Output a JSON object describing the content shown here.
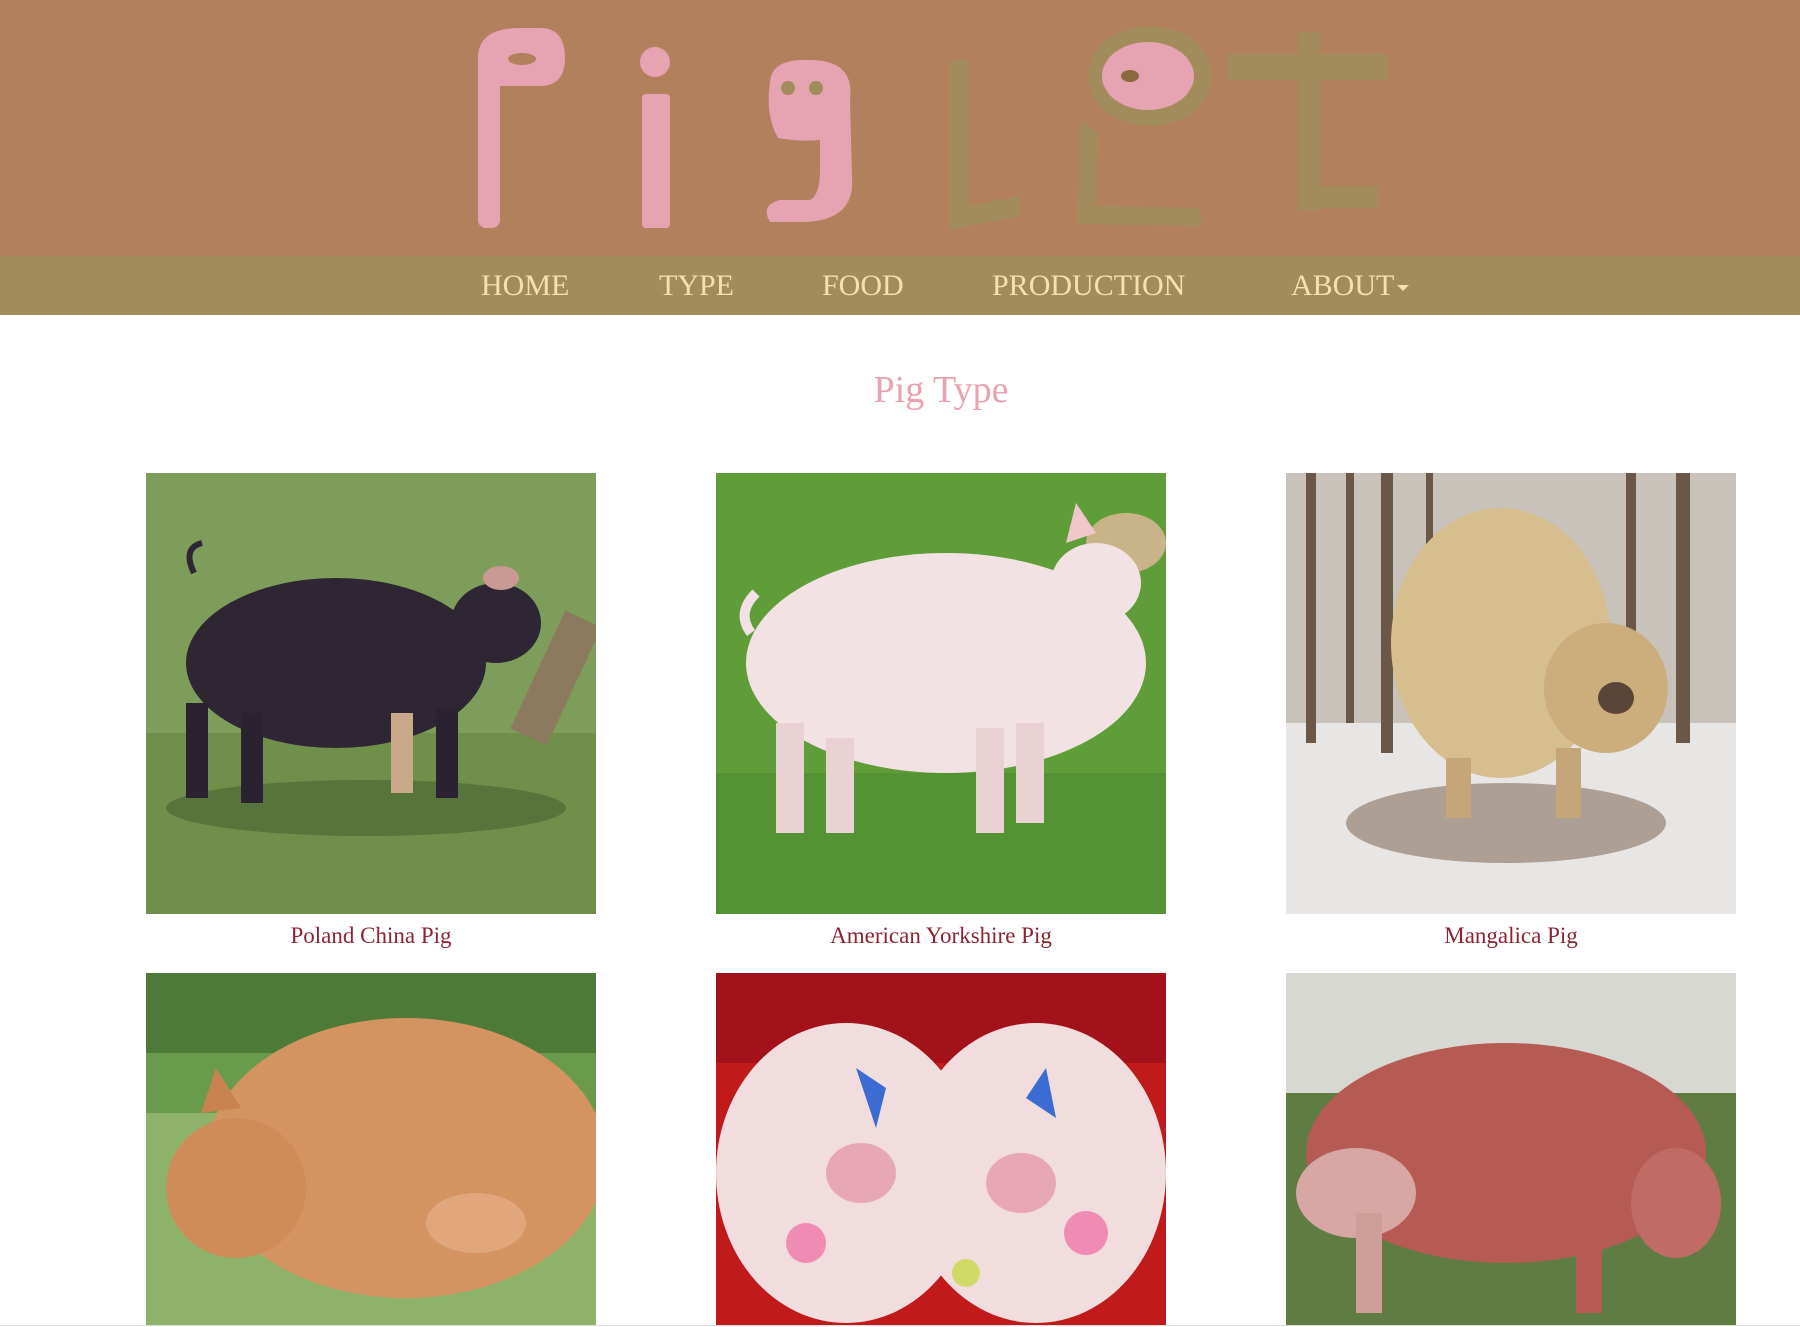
{
  "header": {
    "logo_text": "PigLet"
  },
  "nav": {
    "items": [
      {
        "label": "HOME"
      },
      {
        "label": "TYPE"
      },
      {
        "label": "FOOD"
      },
      {
        "label": "PRODUCTION"
      },
      {
        "label": "ABOUT"
      }
    ]
  },
  "main": {
    "title": "Pig Type",
    "pigs": [
      {
        "name": "Poland China Pig"
      },
      {
        "name": "American Yorkshire Pig"
      },
      {
        "name": "Mangalica Pig"
      },
      {
        "name": ""
      },
      {
        "name": ""
      },
      {
        "name": ""
      }
    ]
  },
  "colors": {
    "header_bg": "#b3805e",
    "nav_bg": "#a38c5c",
    "nav_text": "#f7e0b0",
    "title_pink": "#e8a2b0",
    "caption_red": "#8b2330",
    "logo_pink": "#e6a3b1",
    "logo_olive": "#a38c5c"
  }
}
